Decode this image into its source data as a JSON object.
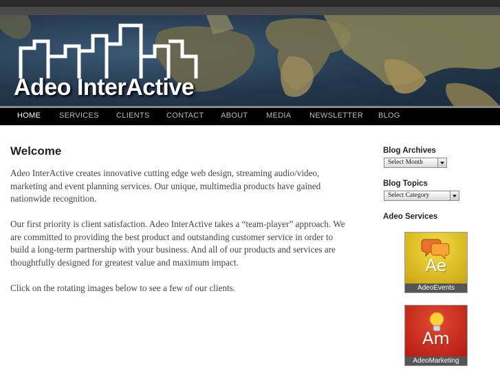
{
  "brand": {
    "name": "Adeo InterActive"
  },
  "nav": {
    "items": [
      {
        "label": "HOME",
        "active": true
      },
      {
        "label": "SERVICES"
      },
      {
        "label": "CLIENTS"
      },
      {
        "label": "CONTACT"
      },
      {
        "label": "ABOUT"
      },
      {
        "label": "MEDIA"
      },
      {
        "label": "NEWSLETTER"
      },
      {
        "label": "BLOG"
      }
    ]
  },
  "main": {
    "title": "Welcome",
    "paragraphs": [
      "Adeo InterActive creates innovative cutting edge web design, streaming audio/video, marketing and event planning services. Our unique, multimedia products have gained nationwide recognition.",
      "Our first priority is client satisfaction. Adeo InterActive takes a “team-player” approach. We are committed to providing the best product and outstanding customer service in order to build a long-term partnership with your business. And all of our products and services are thoughtfully designed for greatest value and maximum impact.",
      "Click on the rotating images below to see a few of our clients."
    ]
  },
  "sidebar": {
    "archives": {
      "title": "Blog Archives",
      "selected": "Select Month"
    },
    "topics": {
      "title": "Blog Topics",
      "selected": "Select Category"
    },
    "services": {
      "title": "Adeo Services",
      "items": [
        {
          "abbr": "Ae",
          "caption": "AdeoEvents",
          "color": "#d8b820",
          "icon": "speech-bubbles-icon"
        },
        {
          "abbr": "Am",
          "caption": "AdeoMarketing",
          "color": "#cc2a1c",
          "icon": "lightbulb-icon"
        }
      ]
    }
  },
  "colors": {
    "nav_bg": "#000000",
    "banner_bg": "#23374c"
  }
}
